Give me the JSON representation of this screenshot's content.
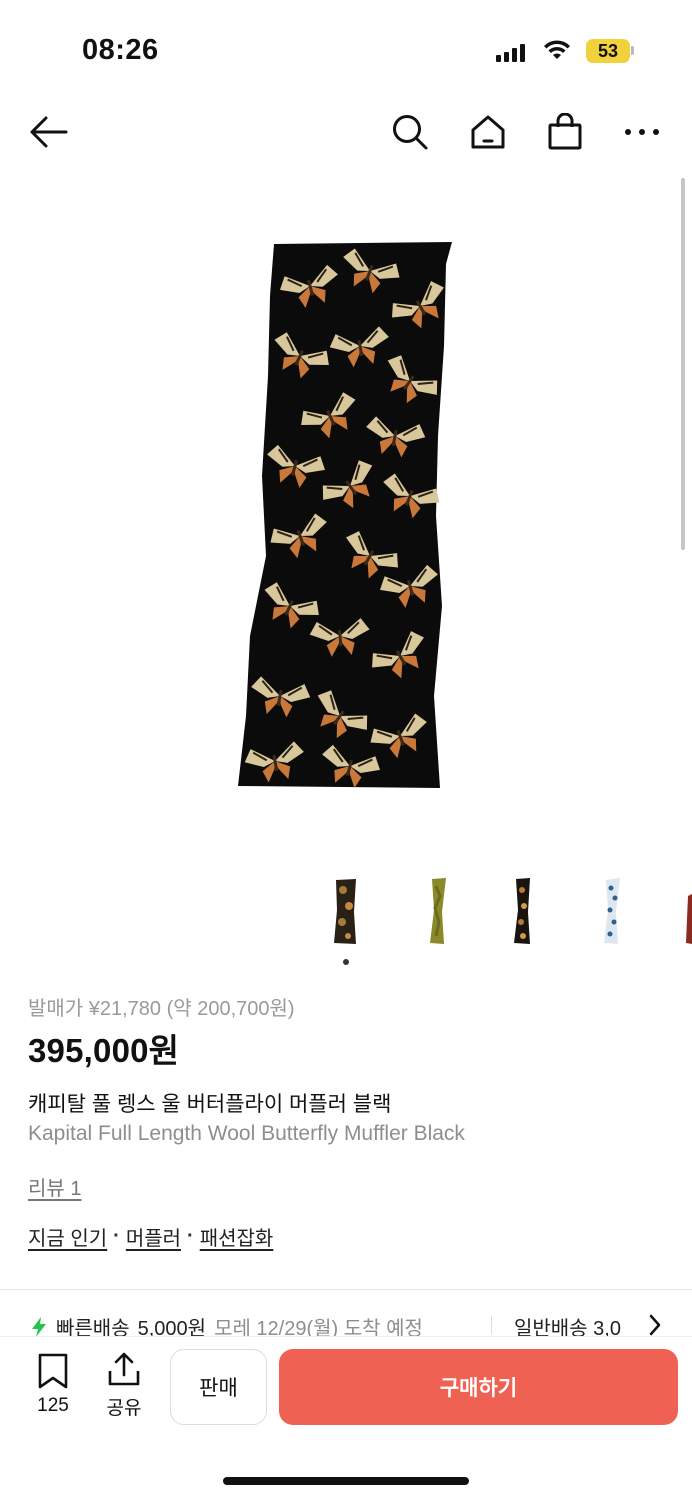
{
  "status": {
    "time": "08:26",
    "battery": "53",
    "battery_color": "#f2d23c"
  },
  "nav": {
    "back_icon": "arrow-left",
    "search_icon": "magnifier",
    "home_icon": "house",
    "cart_icon": "shopping-bag",
    "more_icon": "ellipsis"
  },
  "product": {
    "release_price": "발매가 ¥21,780 (약 200,700원)",
    "price": "395,000원",
    "name_ko": "캐피탈 풀 렝스 울 버터플라이 머플러 블랙",
    "name_en": "Kapital Full Length Wool Butterfly Muffler Black",
    "review": "리뷰 1",
    "tags": [
      "지금 인기",
      "머플러",
      "패션잡화"
    ],
    "tag_separator": "·"
  },
  "thumbnails": {
    "active_index": 0,
    "count": 5
  },
  "shipping": {
    "fast_label": "빠른배송",
    "fast_price": "5,000원",
    "fast_date": "모레 12/29(월) 도착 예정",
    "normal_label": "일반배송 3,0",
    "accent": "#27c24c"
  },
  "actions": {
    "bookmark_count": "125",
    "share_label": "공유",
    "sell_label": "판매",
    "buy_label": "구매하기",
    "buy_color": "#ef6253"
  }
}
